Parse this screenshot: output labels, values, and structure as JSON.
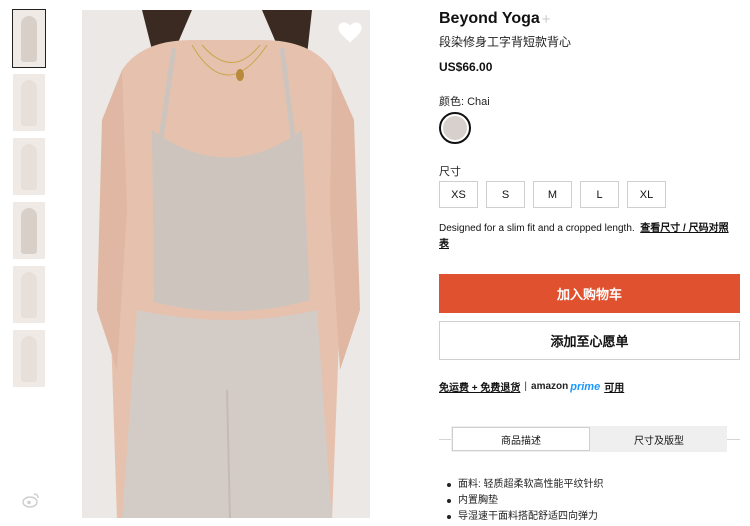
{
  "gallery": {
    "thumbnails": [
      {
        "name": "thumb-1",
        "active": true
      },
      {
        "name": "thumb-2",
        "active": false
      },
      {
        "name": "thumb-3",
        "active": false
      },
      {
        "name": "thumb-4",
        "active": false
      },
      {
        "name": "thumb-5",
        "active": false
      },
      {
        "name": "thumb-6",
        "active": false
      }
    ],
    "share_icon": "weibo-icon",
    "wishlist_icon": "heart-icon"
  },
  "product": {
    "brand": "Beyond Yoga",
    "brand_follow_icon": "+",
    "title": "段染修身工字背短款背心",
    "price": "US$66.00"
  },
  "color": {
    "label": "颜色: Chai",
    "swatch_color": "#d8d0cc"
  },
  "size": {
    "label": "尺寸",
    "options": [
      "XS",
      "S",
      "M",
      "L",
      "XL"
    ]
  },
  "fit": {
    "note": "Designed for a slim fit and a cropped length.",
    "link": "查看尺寸 / 尺码对照表"
  },
  "actions": {
    "add_to_cart": "加入购物车",
    "add_to_wishlist": "添加至心愿单"
  },
  "shipping": {
    "free_shipping": "免运费 + 免费退货",
    "separator": "|",
    "amazon": "amazon",
    "prime": "prime",
    "available": "可用"
  },
  "tabs": [
    {
      "label": "商品描述",
      "active": true
    },
    {
      "label": "尺寸及版型",
      "active": false
    }
  ],
  "features": [
    "面料: 轻质超柔软高性能平纹针织",
    "内置胸垫",
    "导湿速干面料搭配舒适四向弹力"
  ],
  "colors": {
    "accent": "#e0522f",
    "prime_blue": "#1a98ff",
    "garment": "#cdc4be"
  }
}
